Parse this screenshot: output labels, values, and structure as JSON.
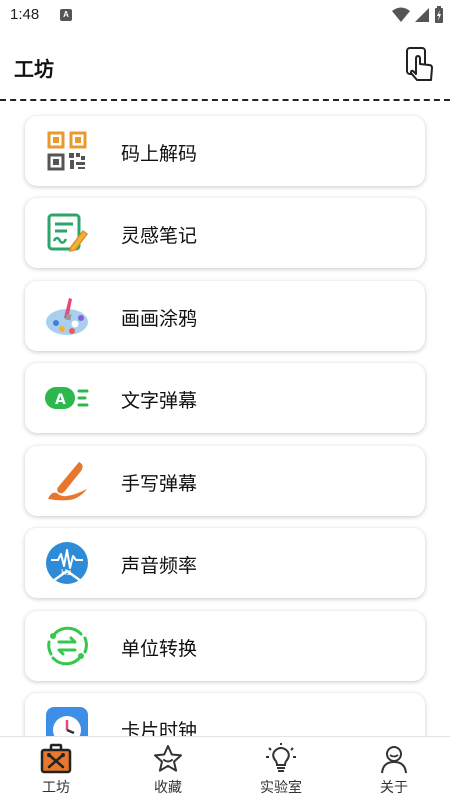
{
  "status_bar": {
    "time": "1:48",
    "badge": "A"
  },
  "header": {
    "title": "工坊",
    "action_icon": "touch-hand-icon"
  },
  "tools": [
    {
      "label": "码上解码",
      "icon": "qr-code-icon"
    },
    {
      "label": "灵感笔记",
      "icon": "note-pen-icon"
    },
    {
      "label": "画画涂鸦",
      "icon": "paint-palette-icon"
    },
    {
      "label": "文字弹幕",
      "icon": "text-danmaku-icon"
    },
    {
      "label": "手写弹幕",
      "icon": "handwriting-brush-icon"
    },
    {
      "label": "声音频率",
      "icon": "sound-frequency-icon"
    },
    {
      "label": "单位转换",
      "icon": "unit-convert-icon"
    },
    {
      "label": "卡片时钟",
      "icon": "card-clock-icon"
    }
  ],
  "tabs": [
    {
      "label": "工坊",
      "icon": "toolbox-icon",
      "active": true
    },
    {
      "label": "收藏",
      "icon": "star-icon",
      "active": false
    },
    {
      "label": "实验室",
      "icon": "lightbulb-icon",
      "active": false
    },
    {
      "label": "关于",
      "icon": "person-icon",
      "active": false
    }
  ],
  "colors": {
    "accent_orange": "#E8772E",
    "text": "#111111",
    "divider": "#222222"
  }
}
